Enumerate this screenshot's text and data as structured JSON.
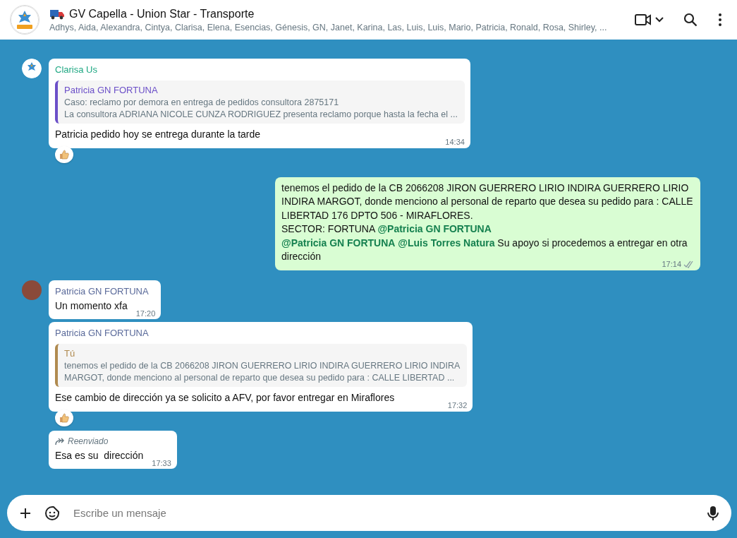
{
  "header": {
    "title": "GV Capella - Union Star - Transporte",
    "participants": "Adhys, Aida, Alexandra, Cintya, Clarisa, Elena, Esencias, Génesis, GN, Janet, Karina, Las, Luis, Luis, Mario, Patricia, Ronald, Rosa, Shirley, ..."
  },
  "messages": [
    {
      "kind": "incoming",
      "avatar": {
        "kind": "logo"
      },
      "sender": "Clarisa Us",
      "color": "#1fa883",
      "quote": {
        "author": "Patricia GN FORTUNA",
        "color": "#6b4fc8",
        "lines": [
          "Caso: reclamo por demora en entrega de pedidos consultora 2875171",
          "La consultora ADRIANA NICOLE CUNZA RODRIGUEZ presenta reclamo porque hasta la fecha el ..."
        ]
      },
      "text": "Patricia pedido hoy se entrega durante la tarde",
      "time": "14:34",
      "reaction": true
    },
    {
      "kind": "outgoing",
      "text": "tenemos el pedido de la CB 2066208 JIRON GUERRERO LIRIO INDIRA GUERRERO LIRIO INDIRA MARGOT, donde menciono al personal de reparto que desea su pedido para : CALLE LIBERTAD 176 DPTO 506 - MIRAFLORES.\nSECTOR: FORTUNA **@Patricia GN FORTUNA**\n**@Patricia GN FORTUNA** **@Luis Torres Natura** Su apoyo si procedemos a entregar en otra dirección",
      "time": "17:14",
      "read": false,
      "reaction": false
    },
    {
      "kind": "incoming",
      "avatar": {
        "kind": "photo"
      },
      "sender": "Patricia GN FORTUNA",
      "color": "#5a6a9a",
      "text": "Un momento xfa",
      "time": "17:20",
      "reaction": false
    },
    {
      "kind": "incoming",
      "sender": "Patricia GN FORTUNA",
      "color": "#5a6a9a",
      "quote": {
        "author": "Tú",
        "color": "#b08a4f",
        "lines": [
          "tenemos el pedido de la CB 2066208 JIRON GUERRERO LIRIO INDIRA GUERRERO LIRIO INDIRA",
          "MARGOT, donde menciono al personal de reparto que desea su pedido para : CALLE LIBERTAD ..."
        ]
      },
      "text": "Ese cambio de dirección ya se solicito a AFV, por favor entregar en Miraflores",
      "time": "17:32",
      "reaction": true
    },
    {
      "kind": "incoming",
      "forwarded": "Reenviado",
      "text": "Esa es su  dirección",
      "time": "17:33",
      "reaction": false
    }
  ],
  "composer": {
    "placeholder": "Escribe un mensaje"
  }
}
